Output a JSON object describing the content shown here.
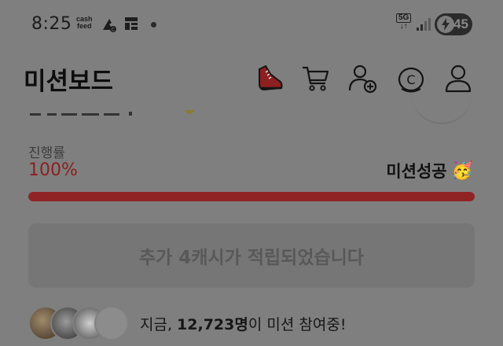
{
  "status_bar": {
    "time": "8:25",
    "app_badge_line1": "cash",
    "app_badge_line2": "feed",
    "network": "5G",
    "battery": "45"
  },
  "header": {
    "title": "미션보드",
    "icons": [
      "sneaker-icon",
      "cart-icon",
      "add-friend-icon",
      "coin-icon",
      "profile-icon"
    ]
  },
  "progress": {
    "label": "진행률",
    "value_text": "100%",
    "fraction": 1.0,
    "status_text": "미션성공",
    "status_emoji": "🥳"
  },
  "reward_button": {
    "label": "추가 4캐시가 적립되었습니다"
  },
  "participants": {
    "prefix": "지금, ",
    "count": "12,723명",
    "suffix": "이 미션 참여중!"
  },
  "colors": {
    "accent": "#902424",
    "overlay": "#7f7f7f"
  }
}
